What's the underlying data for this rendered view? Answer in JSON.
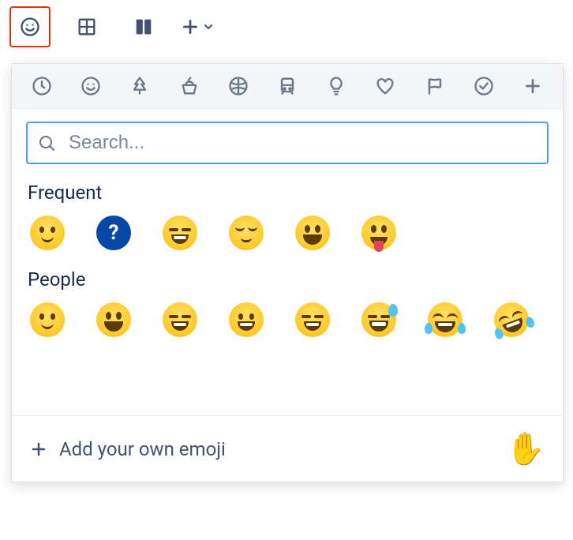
{
  "toolbar": {
    "emoji_label": "Emoji",
    "table_label": "Table",
    "layout_label": "Layouts",
    "insert_label": "Insert"
  },
  "picker": {
    "categories": [
      {
        "name": "frequent",
        "icon": "clock"
      },
      {
        "name": "people",
        "icon": "smile"
      },
      {
        "name": "nature",
        "icon": "tree"
      },
      {
        "name": "food",
        "icon": "food"
      },
      {
        "name": "activity",
        "icon": "ball"
      },
      {
        "name": "travel",
        "icon": "train"
      },
      {
        "name": "objects",
        "icon": "bulb"
      },
      {
        "name": "symbols",
        "icon": "heart"
      },
      {
        "name": "flags",
        "icon": "flag"
      },
      {
        "name": "productivity",
        "icon": "check"
      },
      {
        "name": "custom",
        "icon": "plus"
      }
    ],
    "search_placeholder": "Search...",
    "sections": {
      "frequent": {
        "title": "Frequent",
        "items": [
          "slightly_smiling_face",
          "question",
          "laughing",
          "relieved",
          "smiley",
          "stuck_out_tongue"
        ]
      },
      "people": {
        "title": "People",
        "items": [
          "slightly_smiling_face",
          "smiley",
          "smile",
          "grin",
          "laughing",
          "sweat_smile",
          "joy",
          "rofl"
        ]
      }
    },
    "footer": {
      "add_label": "Add your own emoji",
      "preview_emoji": "raised_hand"
    }
  }
}
